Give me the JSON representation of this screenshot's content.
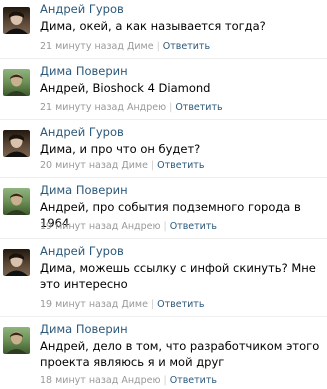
{
  "colors": {
    "link": "#2b587a",
    "meta": "#999999",
    "text": "#000000"
  },
  "comments": [
    {
      "author": "Андрей Гуров",
      "text": "Дима, окей, а как называется тогда?",
      "time": "21 минуту назад Диме",
      "reply": "Ответить",
      "avatar_icon": "person-dark-icon"
    },
    {
      "author": "Дима Поверин",
      "text": "Андрей, Bioshock 4 Diamond",
      "time": "21 минуту назад Андрею",
      "reply": "Ответить",
      "avatar_icon": "person-green-icon"
    },
    {
      "author": "Андрей Гуров",
      "text": "Дима, и про что он будет?",
      "time": "20 минут назад Диме",
      "reply": "Ответить",
      "avatar_icon": "person-dark-icon"
    },
    {
      "author": "Дима Поверин",
      "text": "Андрей, про события подземного города в 1964",
      "time": "19 минут назад Андрею",
      "reply": "Ответить",
      "avatar_icon": "person-green-icon"
    },
    {
      "author": "Андрей Гуров",
      "text": "Дима, можешь ссылку с инфой скинуть? Мне это интересно",
      "time": "19 минут назад Диме",
      "reply": "Ответить",
      "avatar_icon": "person-dark-icon"
    },
    {
      "author": "Дима Поверин",
      "text": "Андрей, дело в том, что разработчиком этого проекта являюсь я и мой друг",
      "time": "18 минут назад Андрею",
      "reply": "Ответить",
      "avatar_icon": "person-green-icon"
    }
  ]
}
